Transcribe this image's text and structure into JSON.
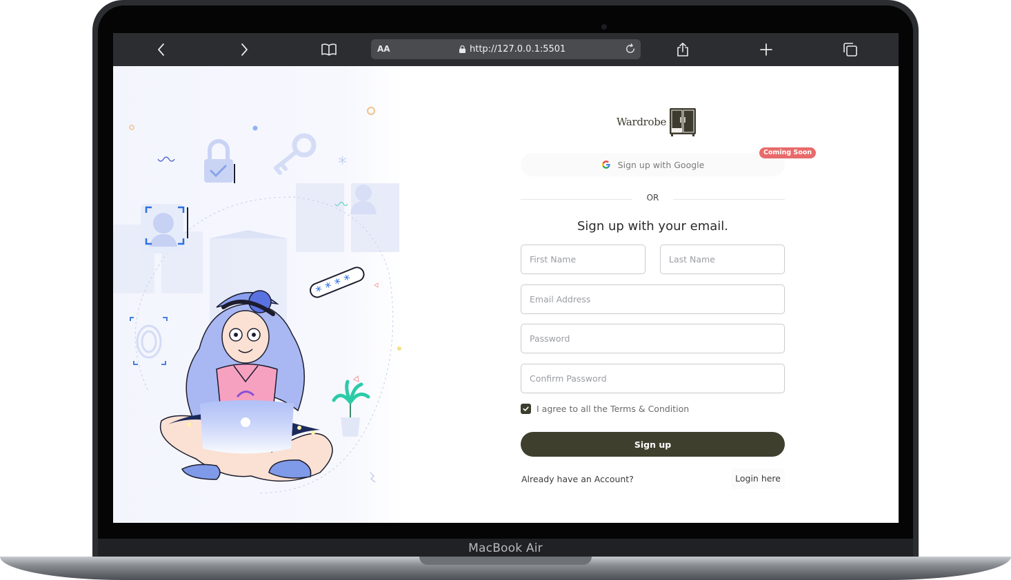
{
  "device": {
    "label": "MacBook Air"
  },
  "browser": {
    "reader_label": "AA",
    "url": "http://127.0.0.1:5501",
    "icons": [
      "chevron-left-icon",
      "chevron-right-icon",
      "book-icon",
      "lock-icon",
      "reload-icon",
      "share-icon",
      "plus-icon",
      "tabs-icon"
    ]
  },
  "brand": {
    "name": "Wardrobe",
    "icon": "wardrobe-icon",
    "color": "#3d3a2e"
  },
  "google": {
    "label": "Sign up with Google",
    "badge": "Coming Soon",
    "badge_color": "#e86a6a"
  },
  "divider": {
    "text": "OR"
  },
  "form": {
    "heading": "Sign up with your email.",
    "first_name_placeholder": "First Name",
    "last_name_placeholder": "Last Name",
    "email_placeholder": "Email Address",
    "password_placeholder": "Password",
    "confirm_placeholder": "Confirm Password",
    "terms_label": "I agree to all the Terms & Condition",
    "terms_checked": true,
    "submit_label": "Sign up",
    "submit_color": "#3f3f2e"
  },
  "footer": {
    "prompt": "Already have an Account?",
    "login_label": "Login here"
  }
}
